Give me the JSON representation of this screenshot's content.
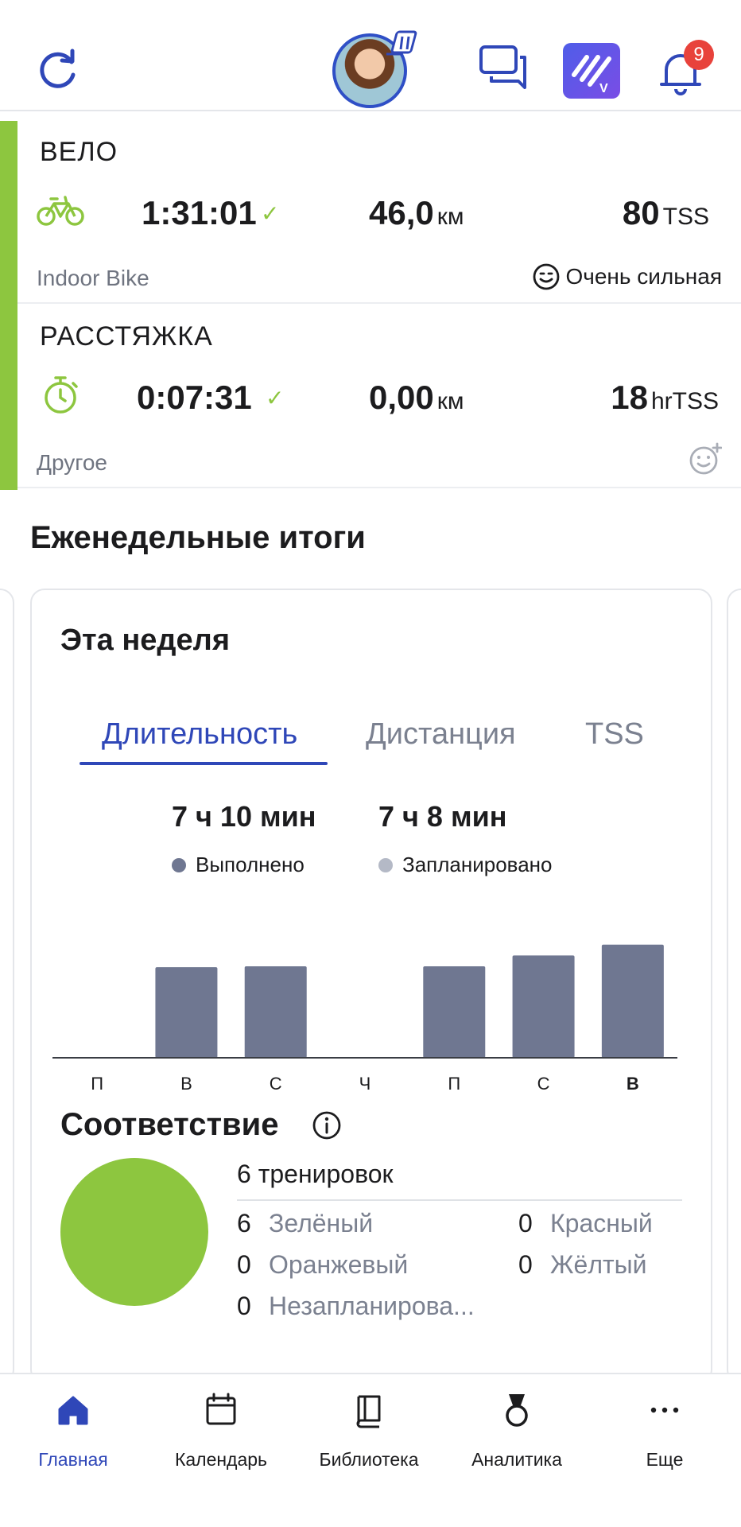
{
  "header": {
    "notification_count": "9",
    "accent": "#2f47b8"
  },
  "activities": [
    {
      "title": "ВЕЛО",
      "icon": "bike-icon",
      "duration": "1:31:01",
      "distance": "46,0",
      "distance_unit": "км",
      "tss": "80",
      "tss_unit": "TSS",
      "subtitle": "Indoor Bike",
      "feeling": "Очень сильная"
    },
    {
      "title": "РАССТЯЖКА",
      "icon": "stopwatch-icon",
      "duration": "0:07:31",
      "distance": "0,00",
      "distance_unit": "км",
      "tss": "18",
      "tss_unit": "hrTSS",
      "subtitle": "Другое"
    }
  ],
  "weekly": {
    "section_title": "Еженедельные итоги",
    "card_title": "Эта неделя",
    "tabs": [
      "Длительность",
      "Дистанция",
      "TSS"
    ],
    "active_tab": 0,
    "completed_total": "7 ч 10 мин",
    "planned_total": "7 ч 8 мин",
    "completed_label": "Выполнено",
    "planned_label": "Запланировано",
    "completed_color": "#6f7791",
    "planned_color": "#b4b9c6"
  },
  "chart_data": {
    "type": "bar",
    "categories": [
      "П",
      "В",
      "С",
      "Ч",
      "П",
      "С",
      "В"
    ],
    "series": [
      {
        "name": "Выполнено",
        "values": [
          0,
          1.0,
          1.01,
          0,
          1.01,
          1.13,
          1.25
        ]
      }
    ],
    "ylim": [
      0,
      1.3
    ],
    "highlight_category_index": 6,
    "grid": false
  },
  "compliance": {
    "title": "Соответствие",
    "workouts": "6 тренировок",
    "pie_color": "#8dc63f",
    "rows": [
      {
        "count": "6",
        "label": "Зелёный"
      },
      {
        "count": "0",
        "label": "Красный"
      },
      {
        "count": "0",
        "label": "Оранжевый"
      },
      {
        "count": "0",
        "label": "Жёлтый"
      },
      {
        "count": "0",
        "label": "Незапланирова..."
      }
    ]
  },
  "nav": {
    "items": [
      {
        "label": "Главная",
        "icon": "home-icon"
      },
      {
        "label": "Календарь",
        "icon": "calendar-icon"
      },
      {
        "label": "Библиотека",
        "icon": "book-icon"
      },
      {
        "label": "Аналитика",
        "icon": "medal-icon"
      },
      {
        "label": "Еще",
        "icon": "more-icon"
      }
    ]
  }
}
